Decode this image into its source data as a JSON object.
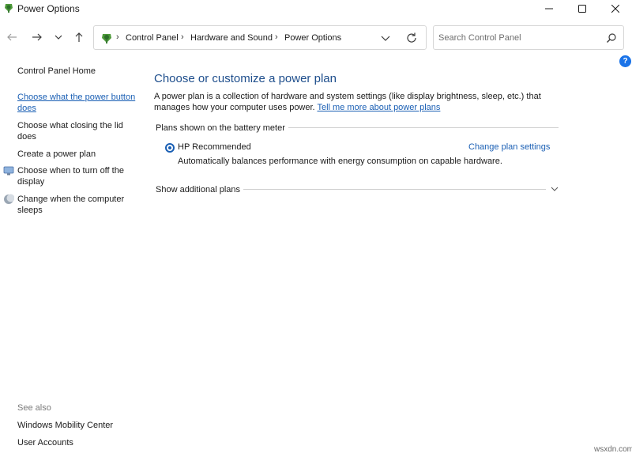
{
  "window": {
    "title": "Power Options",
    "minimize_glyph": "—",
    "maximize_glyph": "☐",
    "close_glyph": "✕"
  },
  "address": {
    "crumbs": [
      "Control Panel",
      "Hardware and Sound",
      "Power Options"
    ],
    "separator": "›"
  },
  "search": {
    "placeholder": "Search Control Panel"
  },
  "help_glyph": "?",
  "sidebar": {
    "home": "Control Panel Home",
    "items": [
      {
        "label": "Choose what the power button",
        "label2": "does"
      },
      {
        "label": "Choose what closing the lid",
        "label2": "does"
      },
      {
        "label": "Create a power plan"
      },
      {
        "label": "Choose when to turn off the",
        "label2": "display",
        "icon": "monitor-icon"
      },
      {
        "label": "Change when the computer",
        "label2": "sleeps",
        "icon": "moon-icon"
      }
    ],
    "see_also": "See also",
    "see_also_items": [
      "Windows Mobility Center",
      "User Accounts"
    ]
  },
  "main": {
    "title": "Choose or customize a power plan",
    "description": "A power plan is a collection of hardware and system settings (like display brightness, sleep, etc.) that manages how your computer uses power.",
    "description_line1": "A power plan is a collection of hardware and system settings (like display brightness, sleep, etc.) that",
    "description_line2": "manages how your computer uses power.",
    "learn_more": "Tell me more about power plans",
    "section_label": "Plans shown on the battery meter",
    "plan": {
      "name": "HP Recommended",
      "selected": true,
      "settings_link": "Change plan settings",
      "description": "Automatically balances performance with energy consumption on capable hardware."
    },
    "additional_plans": "Show additional plans"
  },
  "watermark": "wsxdn.com",
  "colors": {
    "link": "#1a5fb4",
    "title": "#1e4e8c",
    "help": "#1a73e8"
  }
}
